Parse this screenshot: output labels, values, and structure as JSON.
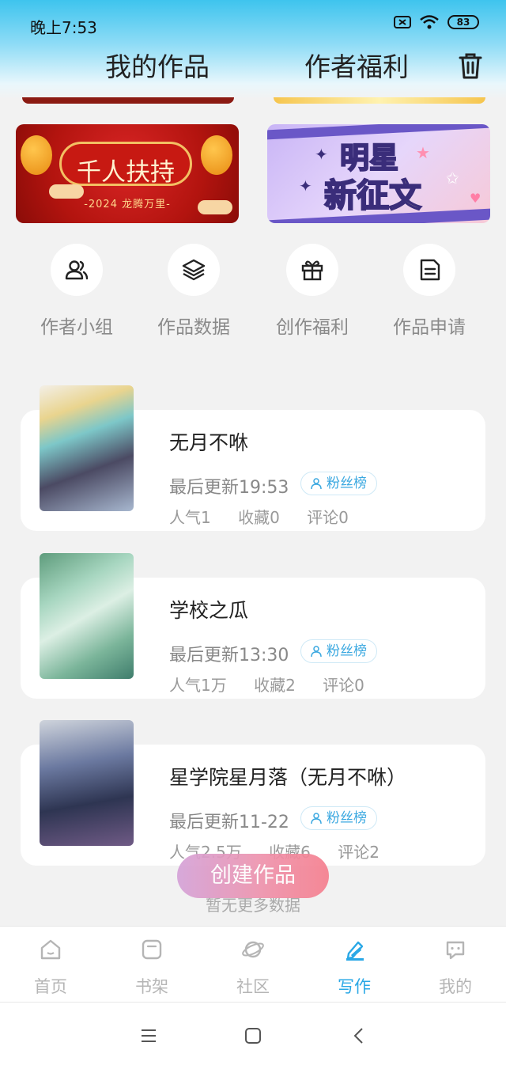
{
  "status_bar": {
    "time": "晚上7:53",
    "battery": "83"
  },
  "header": {
    "tabs": [
      "我的作品",
      "作者福利"
    ]
  },
  "banners": [
    {
      "title": "千人扶持",
      "subtitle": "-2024 龙腾万里-"
    },
    {
      "line1": "明星",
      "line2": "新征文"
    }
  ],
  "quick_actions": [
    {
      "label": "作者小组",
      "icon": "users-icon"
    },
    {
      "label": "作品数据",
      "icon": "layers-icon"
    },
    {
      "label": "创作福利",
      "icon": "gift-icon"
    },
    {
      "label": "作品申请",
      "icon": "document-icon"
    }
  ],
  "works": [
    {
      "title": "无月不咻",
      "update": "最后更新19:53",
      "badge": "粉丝榜",
      "popularity": "人气1",
      "favorites": "收藏0",
      "comments": "评论0"
    },
    {
      "title": "学校之瓜",
      "update": "最后更新13:30",
      "badge": "粉丝榜",
      "popularity": "人气1万",
      "favorites": "收藏2",
      "comments": "评论0"
    },
    {
      "title": "星学院星月落（无月不咻）",
      "update": "最后更新11-22",
      "badge": "粉丝榜",
      "popularity": "人气2.5万",
      "favorites": "收藏6",
      "comments": "评论2"
    }
  ],
  "no_more_text": "暂无更多数据",
  "create_button": "创建作品",
  "tabbar": [
    {
      "label": "首页",
      "icon": "home-icon"
    },
    {
      "label": "书架",
      "icon": "bookshelf-icon"
    },
    {
      "label": "社区",
      "icon": "planet-icon"
    },
    {
      "label": "写作",
      "icon": "pen-icon"
    },
    {
      "label": "我的",
      "icon": "chat-icon"
    }
  ],
  "active_tab": "写作",
  "accent_color": "#2aa8e6"
}
